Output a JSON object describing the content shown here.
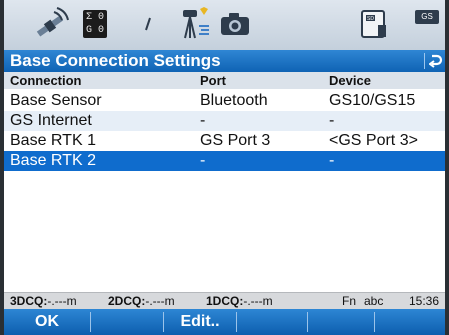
{
  "title": "Base Connection Settings",
  "status_icons": {
    "gs_panel": {
      "row1": "Σ 0",
      "row2": "G 0"
    },
    "gs_small": "GS",
    "sd_label": "SD"
  },
  "table": {
    "headers": {
      "connection": "Connection",
      "port": "Port",
      "device": "Device"
    },
    "rows": [
      {
        "connection": "Base Sensor",
        "port": "Bluetooth",
        "device": "GS10/GS15"
      },
      {
        "connection": "GS Internet",
        "port": "-",
        "device": "-"
      },
      {
        "connection": "Base RTK 1",
        "port": "GS Port 3",
        "device": "<GS Port 3>"
      },
      {
        "connection": "Base RTK 2",
        "port": "-",
        "device": "-"
      }
    ],
    "selected_index": 3
  },
  "status_bar": {
    "dcq3_label": "3DCQ:",
    "dcq3_value": "-.---m",
    "dcq2_label": "2DCQ:",
    "dcq2_value": "-.---m",
    "dcq1_label": "1DCQ:",
    "dcq1_value": "-.---m",
    "fn": "Fn",
    "input_mode": "abc",
    "time": "15:36"
  },
  "softkeys": {
    "f1": "OK",
    "f3": "Edit.."
  },
  "colors": {
    "title_bar": "#0f63b4",
    "selection": "#0f6ccd",
    "header_row": "#dbe2ea"
  }
}
